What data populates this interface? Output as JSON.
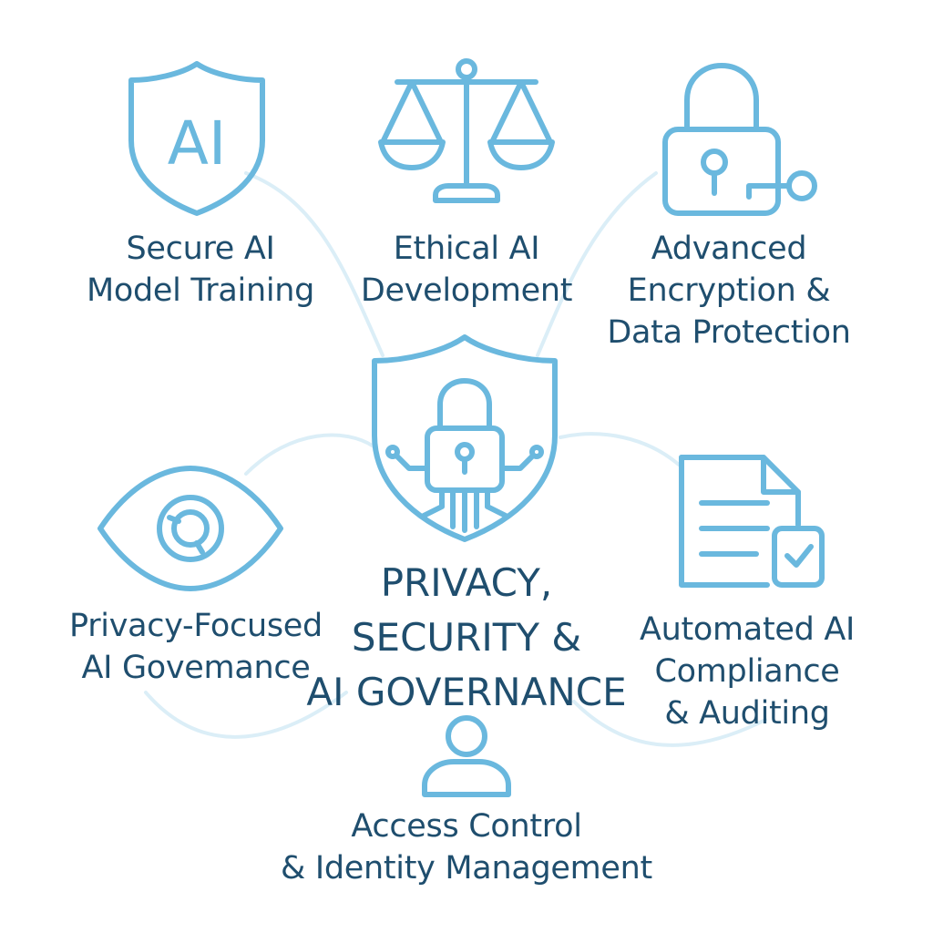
{
  "colors": {
    "icon_stroke": "#6ab8de",
    "text": "#1f4e6e",
    "connector": "#dbeef7",
    "background": "#ffffff"
  },
  "center": {
    "icon": "shield-lock-circuit-icon",
    "title_lines": [
      "PRIVACY,",
      "SECURITY &",
      "AI GOVERNANCE"
    ]
  },
  "nodes": [
    {
      "id": "secure-ai-model-training",
      "icon": "ai-shield-icon",
      "icon_text": "AI",
      "label_lines": [
        "Secure AI",
        "Model Training"
      ]
    },
    {
      "id": "ethical-ai-development",
      "icon": "balance-scale-icon",
      "label_lines": [
        "Ethical AI",
        "Development"
      ]
    },
    {
      "id": "advanced-encryption",
      "icon": "padlock-key-icon",
      "label_lines": [
        "Advanced",
        "Encryption &",
        "Data Protection"
      ]
    },
    {
      "id": "privacy-focused-governance",
      "icon": "eye-icon",
      "label_lines": [
        "Privacy-Focused",
        "AI Govemance"
      ]
    },
    {
      "id": "automated-compliance",
      "icon": "document-checkbox-icon",
      "label_lines": [
        "Automated AI",
        "Compliance",
        "& Auditing"
      ]
    },
    {
      "id": "access-control",
      "icon": "user-icon",
      "label_lines": [
        "Access Control",
        "& Identity Management"
      ]
    }
  ]
}
